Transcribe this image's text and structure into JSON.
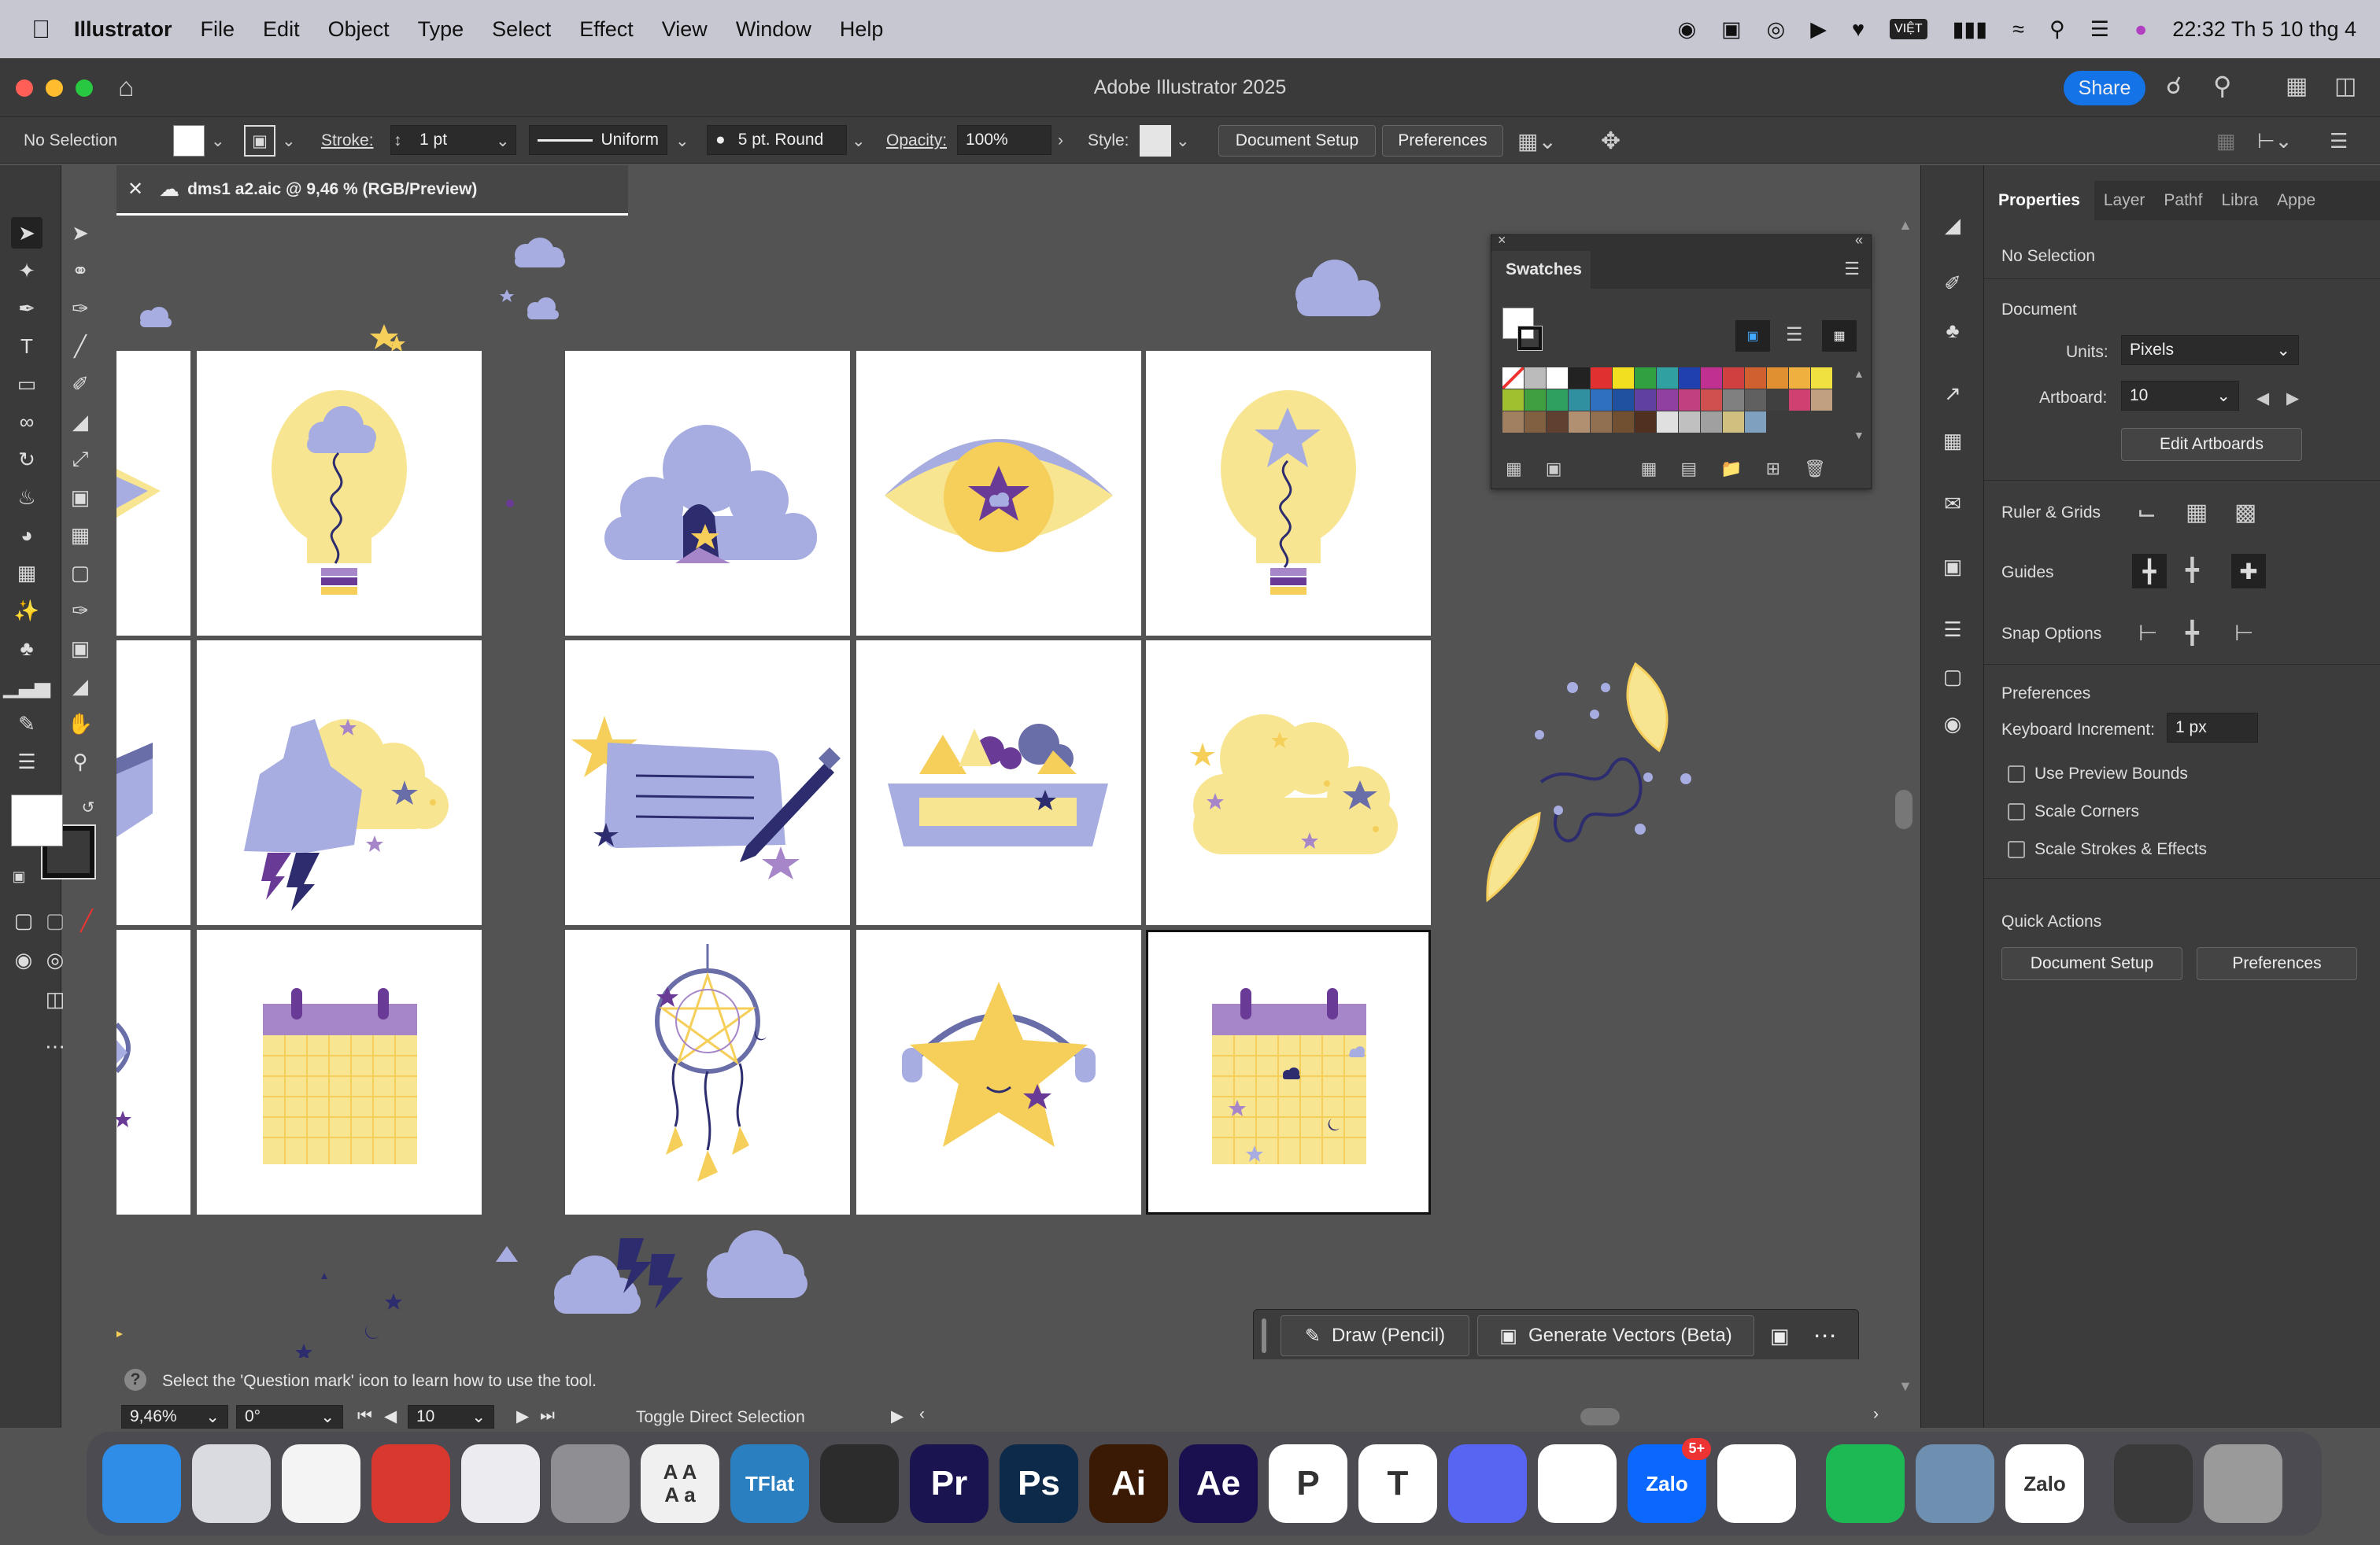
{
  "menubar": {
    "app": "Illustrator",
    "items": [
      "File",
      "Edit",
      "Object",
      "Type",
      "Select",
      "Effect",
      "View",
      "Window",
      "Help"
    ],
    "clock": "22:32 Th 5 10 thg 4",
    "vn_label": "VIỆT"
  },
  "window": {
    "title": "Adobe Illustrator 2025",
    "share_label": "Share"
  },
  "controlbar": {
    "selection": "No Selection",
    "stroke_label": "Stroke:",
    "stroke_value": "1 pt",
    "profile": "Uniform",
    "brush": "5 pt. Round",
    "opacity_label": "Opacity:",
    "opacity_value": "100%",
    "style_label": "Style:",
    "document_setup": "Document Setup",
    "preferences": "Preferences"
  },
  "document_tab": {
    "name": "dms1 a2.aic @ 9,46 % (RGB/Preview)"
  },
  "swatches_panel": {
    "title": "Swatches",
    "colors": [
      "#ffffff",
      "#bbbbbb",
      "#ffffff",
      "#222222",
      "#e03030",
      "#f2e020",
      "#30a040",
      "#30a0a0",
      "#2040b0",
      "#c03090",
      "#d04040",
      "#d06030",
      "#e09030",
      "#f0b040",
      "#f0e040",
      "#a0c030",
      "#40a040",
      "#30a060",
      "#3090a0",
      "#3070c0",
      "#2050a0",
      "#6040a0",
      "#9040a0",
      "#c04080",
      "#d05050",
      "#808080",
      "#606060",
      "#404040",
      "#d04070",
      "#c0a080",
      "#a08060",
      "#806040",
      "#604030",
      "#b09070",
      "#907050",
      "#705030",
      "#503020",
      "#e0e0e0",
      "#c0c0c0",
      "#a0a0a0",
      "#d0c080",
      "#80a0c0"
    ]
  },
  "properties": {
    "tabs": [
      "Properties",
      "Layer",
      "Pathf",
      "Libra",
      "Appe"
    ],
    "no_selection": "No Selection",
    "document_heading": "Document",
    "units_label": "Units:",
    "units_value": "Pixels",
    "artboard_label": "Artboard:",
    "artboard_value": "10",
    "edit_artboards": "Edit Artboards",
    "ruler_grids": "Ruler & Grids",
    "guides": "Guides",
    "snap_options": "Snap Options",
    "preferences_heading": "Preferences",
    "keyboard_increment_label": "Keyboard Increment:",
    "keyboard_increment_value": "1 px",
    "use_preview_bounds": "Use Preview Bounds",
    "scale_corners": "Scale Corners",
    "scale_strokes": "Scale Strokes & Effects",
    "quick_actions": "Quick Actions",
    "document_setup": "Document Setup",
    "preferences": "Preferences"
  },
  "context_bar": {
    "draw": "Draw (Pencil)",
    "generate": "Generate Vectors (Beta)"
  },
  "status": {
    "hint": "Select the 'Question mark' icon to learn how to use the tool.",
    "zoom": "9,46%",
    "rotation": "0°",
    "artboard": "10",
    "tool_hint": "Toggle Direct Selection"
  },
  "dock": {
    "apps": [
      {
        "label": "",
        "color": "#2f8de8",
        "name": "finder"
      },
      {
        "label": "",
        "color": "#d9dbe0",
        "name": "launchpad"
      },
      {
        "label": "",
        "color": "#f4f4f4",
        "name": "photos"
      },
      {
        "label": "",
        "color": "#d8382e",
        "name": "photo-booth"
      },
      {
        "label": "",
        "color": "#ececf0",
        "name": "iphone-mirroring"
      },
      {
        "label": "",
        "color": "#8e8e93",
        "name": "system-settings"
      },
      {
        "label": "A A\nA a",
        "color": "#f0f0f0",
        "name": "font-book"
      },
      {
        "label": "TFlat",
        "color": "#2a7fc0",
        "name": "tflat"
      },
      {
        "label": "",
        "color": "#2c2c2c",
        "name": "blender"
      },
      {
        "label": "Pr",
        "color": "#1a1550",
        "name": "premiere"
      },
      {
        "label": "Ps",
        "color": "#0e2a4a",
        "name": "photoshop"
      },
      {
        "label": "Ai",
        "color": "#3a1a05",
        "name": "illustrator"
      },
      {
        "label": "Ae",
        "color": "#1a1050",
        "name": "after-effects"
      },
      {
        "label": "P",
        "color": "#ffffff",
        "name": "powerpoint"
      },
      {
        "label": "T",
        "color": "#ffffff",
        "name": "teams"
      },
      {
        "label": "",
        "color": "#5865f2",
        "name": "discord"
      },
      {
        "label": "",
        "color": "#ffffff",
        "name": "messenger"
      },
      {
        "label": "Zalo",
        "color": "#0a68ff",
        "name": "zalo"
      },
      {
        "label": "",
        "color": "#ffffff",
        "name": "chrome"
      },
      {
        "label": "",
        "color": "#1db954",
        "name": "spotify"
      },
      {
        "label": "",
        "color": "#6f8fb0",
        "name": "preview"
      },
      {
        "label": "Zalo",
        "color": "#ffffff",
        "name": "zalo-2"
      },
      {
        "label": "",
        "color": "#3a3a3a",
        "name": "recent-window"
      },
      {
        "label": "",
        "color": "#9a9a9a",
        "name": "trash"
      }
    ],
    "zalo_badge": "5+"
  },
  "colors": {
    "lavender": "#a7ade0",
    "yellow": "#f8e592",
    "gold": "#f5cf5a",
    "purple": "#6a3b96",
    "navy": "#2c2c6e",
    "mauve": "#a686c8"
  }
}
